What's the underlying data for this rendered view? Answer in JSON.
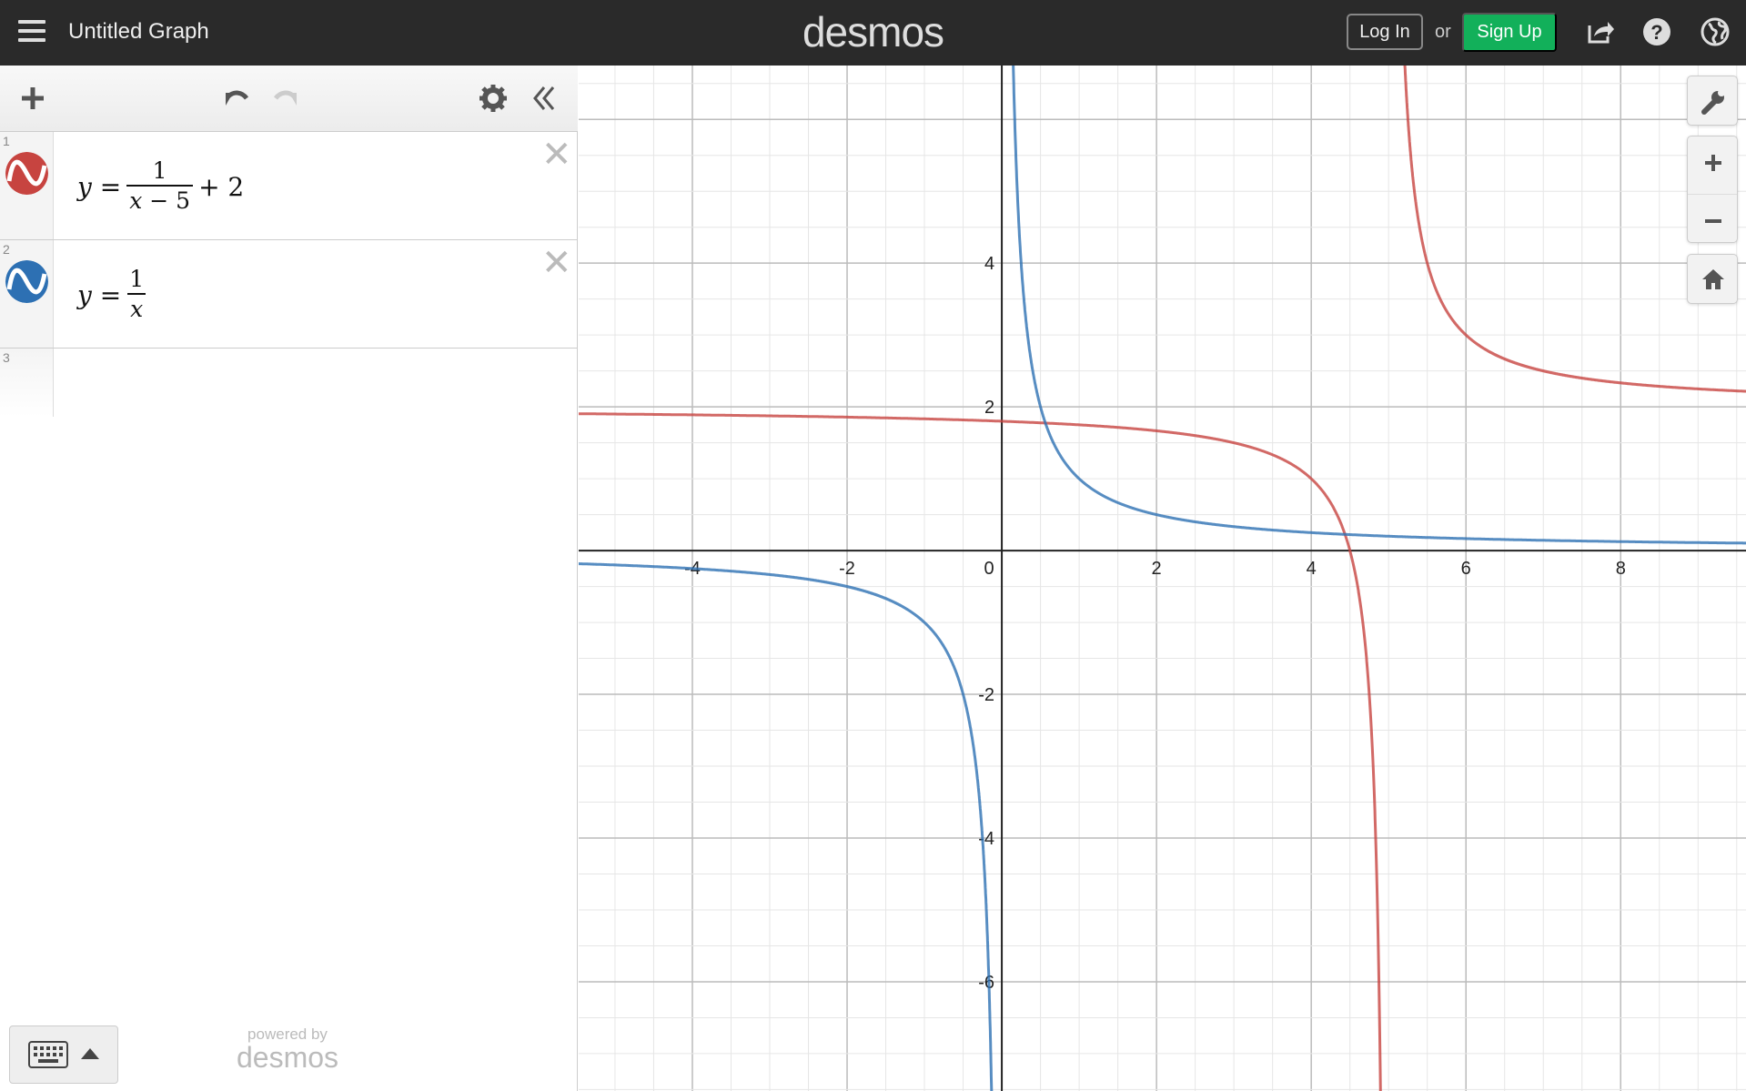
{
  "header": {
    "title": "Untitled Graph",
    "logo": "desmos",
    "login": "Log In",
    "or": "or",
    "signup": "Sign Up"
  },
  "expressions": [
    {
      "index": "1",
      "color": "#c74440",
      "lhs": "y",
      "eq": "=",
      "num": "1",
      "den_var": "x",
      "den_rest": " − 5",
      "tail": "+ 2",
      "shift": 5,
      "offset": 2
    },
    {
      "index": "2",
      "color": "#2d70b3",
      "lhs": "y",
      "eq": "=",
      "num": "1",
      "den_var": "x",
      "den_rest": "",
      "tail": "",
      "shift": 0,
      "offset": 0
    },
    {
      "index": "3"
    }
  ],
  "footer": {
    "powered_by": "powered by",
    "brand": "desmos"
  },
  "graph": {
    "x_ticks": [
      "-4",
      "-2",
      "0",
      "2",
      "4",
      "6",
      "8"
    ],
    "y_ticks": [
      "4",
      "2",
      "-2",
      "-4",
      "-6"
    ],
    "xrange": [
      -5.47,
      9.62
    ],
    "yrange": [
      -7.52,
      6.75
    ]
  }
}
